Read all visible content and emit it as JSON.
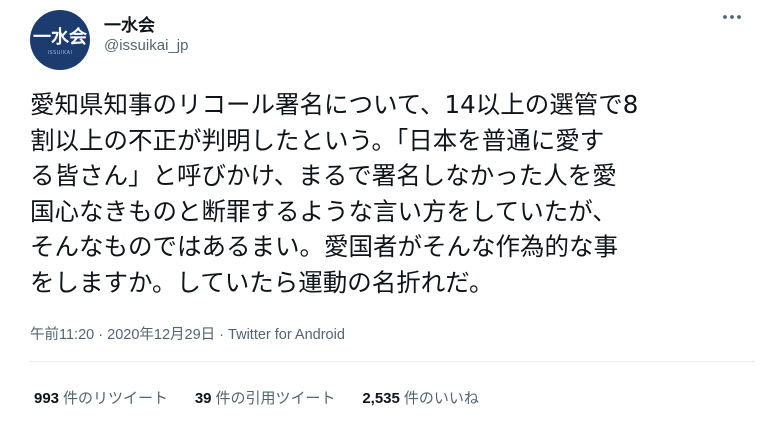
{
  "author": {
    "display_name": "一水会",
    "handle": "@issuikai_jp",
    "avatar_text": "一水会",
    "avatar_subtext": "ISSUIKAI"
  },
  "tweet": {
    "text": "愛知県知事のリコール署名について、14以上の選管で8\n割以上の不正が判明したという。「日本を普通に愛す\nる皆さん」と呼びかけ、まるで署名しなかった人を愛\n国心なきものと断罪するような言い方をしていたが、\nそんなものではあるまい。愛国者がそんな作為的な事\nをしますか。していたら運動の名折れだ。",
    "time": "午前11:20",
    "date": "2020年12月29日",
    "separator": "·",
    "source": "Twitter for Android"
  },
  "stats": {
    "retweets_count": "993",
    "retweets_label": "件のリツイート",
    "quotes_count": "39",
    "quotes_label": "件の引用ツイート",
    "likes_count": "2,535",
    "likes_label": "件のいいね"
  },
  "icons": {
    "more": "more-options-icon"
  },
  "colors": {
    "text_primary": "#0f1419",
    "text_secondary": "#536471",
    "avatar_bg": "#1c3b6e",
    "divider": "#e6ecf0"
  }
}
